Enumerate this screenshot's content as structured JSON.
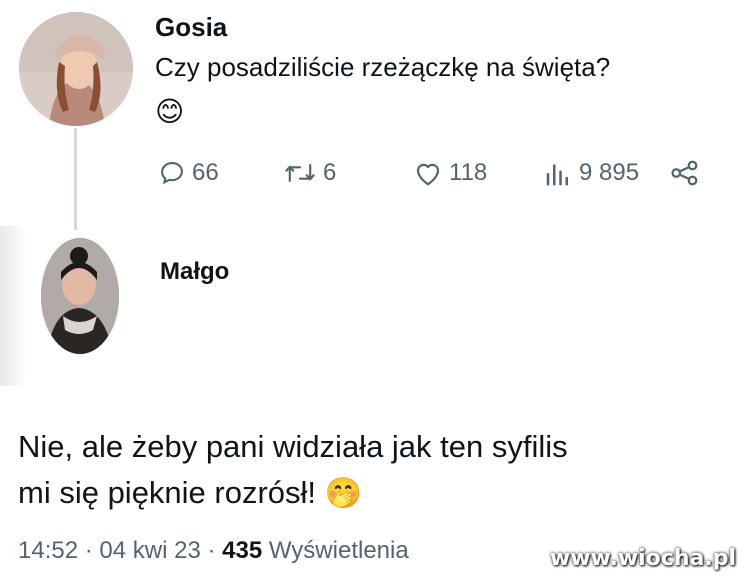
{
  "tweet": {
    "author": "Gosia",
    "text": "Czy posadziliście rzeżączkę na święta?",
    "emoji": "😊",
    "actions": {
      "replies": "66",
      "retweets": "6",
      "likes": "118",
      "views": "9 895"
    }
  },
  "reply": {
    "author": "Małgo",
    "text_line1": "Nie, ale żeby pani widziała jak ten syfilis",
    "text_line2": "mi się pięknie rozrósł!",
    "emoji": "🤭",
    "time": "14:52",
    "sep1": "·",
    "date": "04 kwi 23",
    "sep2": "·",
    "views_count": "435",
    "views_label": "Wyświetlenia"
  },
  "watermark": "www.wiocha.pl",
  "colors": {
    "text": "#0f1419",
    "muted": "#536471",
    "line": "#cfd9de"
  },
  "icons": [
    "reply-icon",
    "retweet-icon",
    "like-icon",
    "views-icon",
    "share-icon"
  ]
}
